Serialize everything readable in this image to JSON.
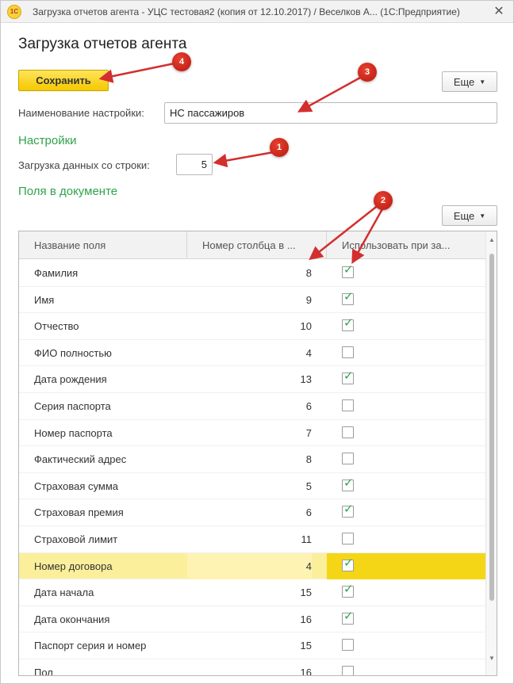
{
  "window": {
    "logo_text": "1С",
    "title": "Загрузка отчетов агента - УЦС тестовая2 (копия от 12.10.2017) / Веселков А... (1С:Предприятие)",
    "close_icon": "close-icon"
  },
  "form": {
    "title": "Загрузка отчетов агента",
    "save_label": "Сохранить",
    "more_label": "Еще",
    "setting_name_label": "Наименование настройки:",
    "setting_name_value": "НС пассажиров",
    "settings_section": "Настройки",
    "start_row_label": "Загрузка данных со строки:",
    "start_row_value": "5",
    "fields_section": "Поля в документе",
    "table_more_label": "Еще"
  },
  "table": {
    "columns": [
      "Название поля",
      "Номер столбца в ...",
      "Использовать при за..."
    ],
    "rows": [
      {
        "name": "Фамилия",
        "col": "8",
        "use": true
      },
      {
        "name": "Имя",
        "col": "9",
        "use": true
      },
      {
        "name": "Отчество",
        "col": "10",
        "use": true
      },
      {
        "name": "ФИО полностью",
        "col": "4",
        "use": false
      },
      {
        "name": "Дата рождения",
        "col": "13",
        "use": true
      },
      {
        "name": "Серия паспорта",
        "col": "6",
        "use": false
      },
      {
        "name": "Номер паспорта",
        "col": "7",
        "use": false
      },
      {
        "name": "Фактический адрес",
        "col": "8",
        "use": false
      },
      {
        "name": "Страховая сумма",
        "col": "5",
        "use": true
      },
      {
        "name": "Страховая премия",
        "col": "6",
        "use": true
      },
      {
        "name": "Страховой лимит",
        "col": "11",
        "use": false
      },
      {
        "name": "Номер договора",
        "col": "4",
        "use": true,
        "selected": true
      },
      {
        "name": "Дата начала",
        "col": "15",
        "use": true
      },
      {
        "name": "Дата окончания",
        "col": "16",
        "use": true
      },
      {
        "name": "Паспорт серия и номер",
        "col": "15",
        "use": false
      },
      {
        "name": "Пол",
        "col": "16",
        "use": false
      }
    ]
  },
  "annotations": {
    "badges": [
      "1",
      "2",
      "3",
      "4"
    ]
  },
  "colors": {
    "accent_green": "#2fa34a",
    "save_yellow": "#f5c800",
    "selection": "#fbef9c",
    "annotation_red": "#d32f2f"
  }
}
